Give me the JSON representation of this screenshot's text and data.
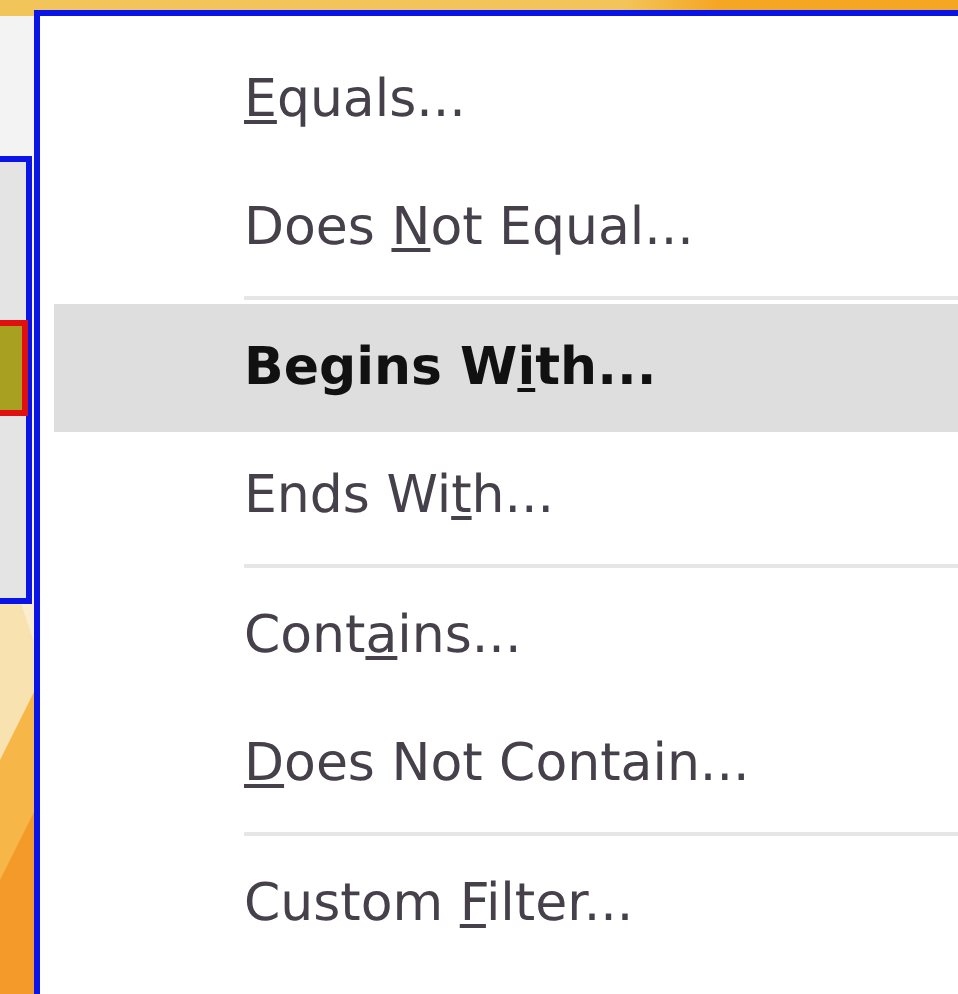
{
  "menu": {
    "groups": [
      [
        {
          "key": "E",
          "post": "quals...",
          "selected": false
        },
        {
          "pre": "Does ",
          "key": "N",
          "post": "ot Equal...",
          "selected": false
        }
      ],
      [
        {
          "pre": "Begins W",
          "key": "i",
          "post": "th...",
          "selected": true
        },
        {
          "pre": "Ends Wi",
          "key": "t",
          "post": "h...",
          "selected": false
        }
      ],
      [
        {
          "pre": "Cont",
          "key": "a",
          "post": "ins...",
          "selected": false
        },
        {
          "key": "D",
          "post": "oes Not Contain...",
          "selected": false
        }
      ],
      [
        {
          "pre": "Custom ",
          "key": "F",
          "post": "ilter...",
          "selected": false
        }
      ]
    ]
  }
}
